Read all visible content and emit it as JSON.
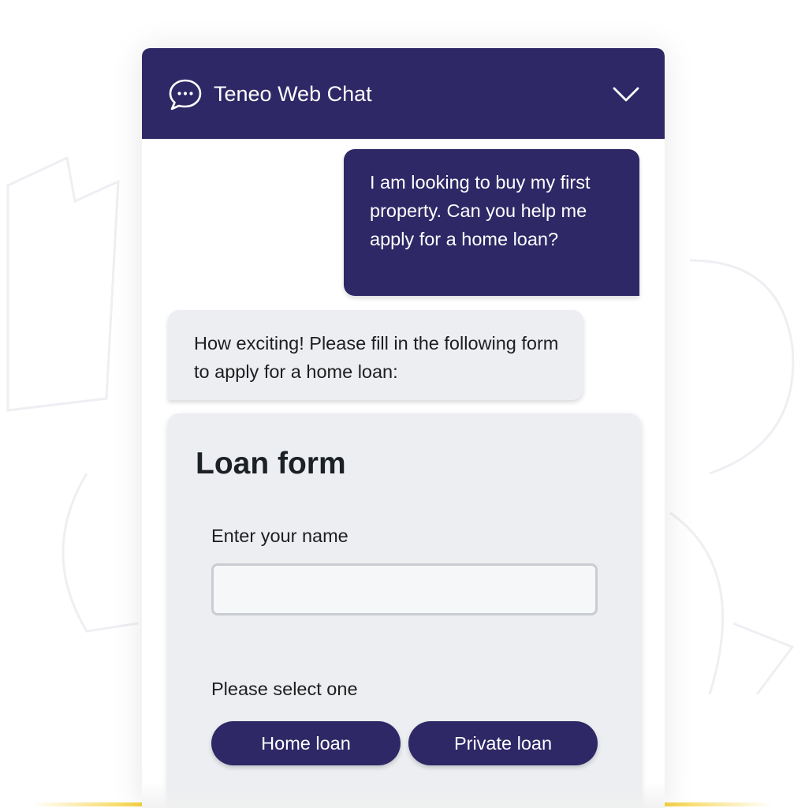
{
  "header": {
    "title": "Teneo Web Chat",
    "icon": "chat-bubble-icon",
    "collapse_icon": "chevron-down-icon",
    "background": "#2f2866"
  },
  "messages": {
    "user": "I am looking to buy my first property. Can you help me apply for a home loan?",
    "bot": "How exciting! Please fill in the following form to apply for a home loan:"
  },
  "form": {
    "title": "Loan form",
    "name_label": "Enter your name",
    "name_value": "",
    "select_label": "Please select one",
    "options": [
      "Home loan",
      "Private loan"
    ]
  },
  "colors": {
    "brand": "#2f2866",
    "bubble_bot": "#eceef2",
    "accent_line": "#f2c200"
  }
}
